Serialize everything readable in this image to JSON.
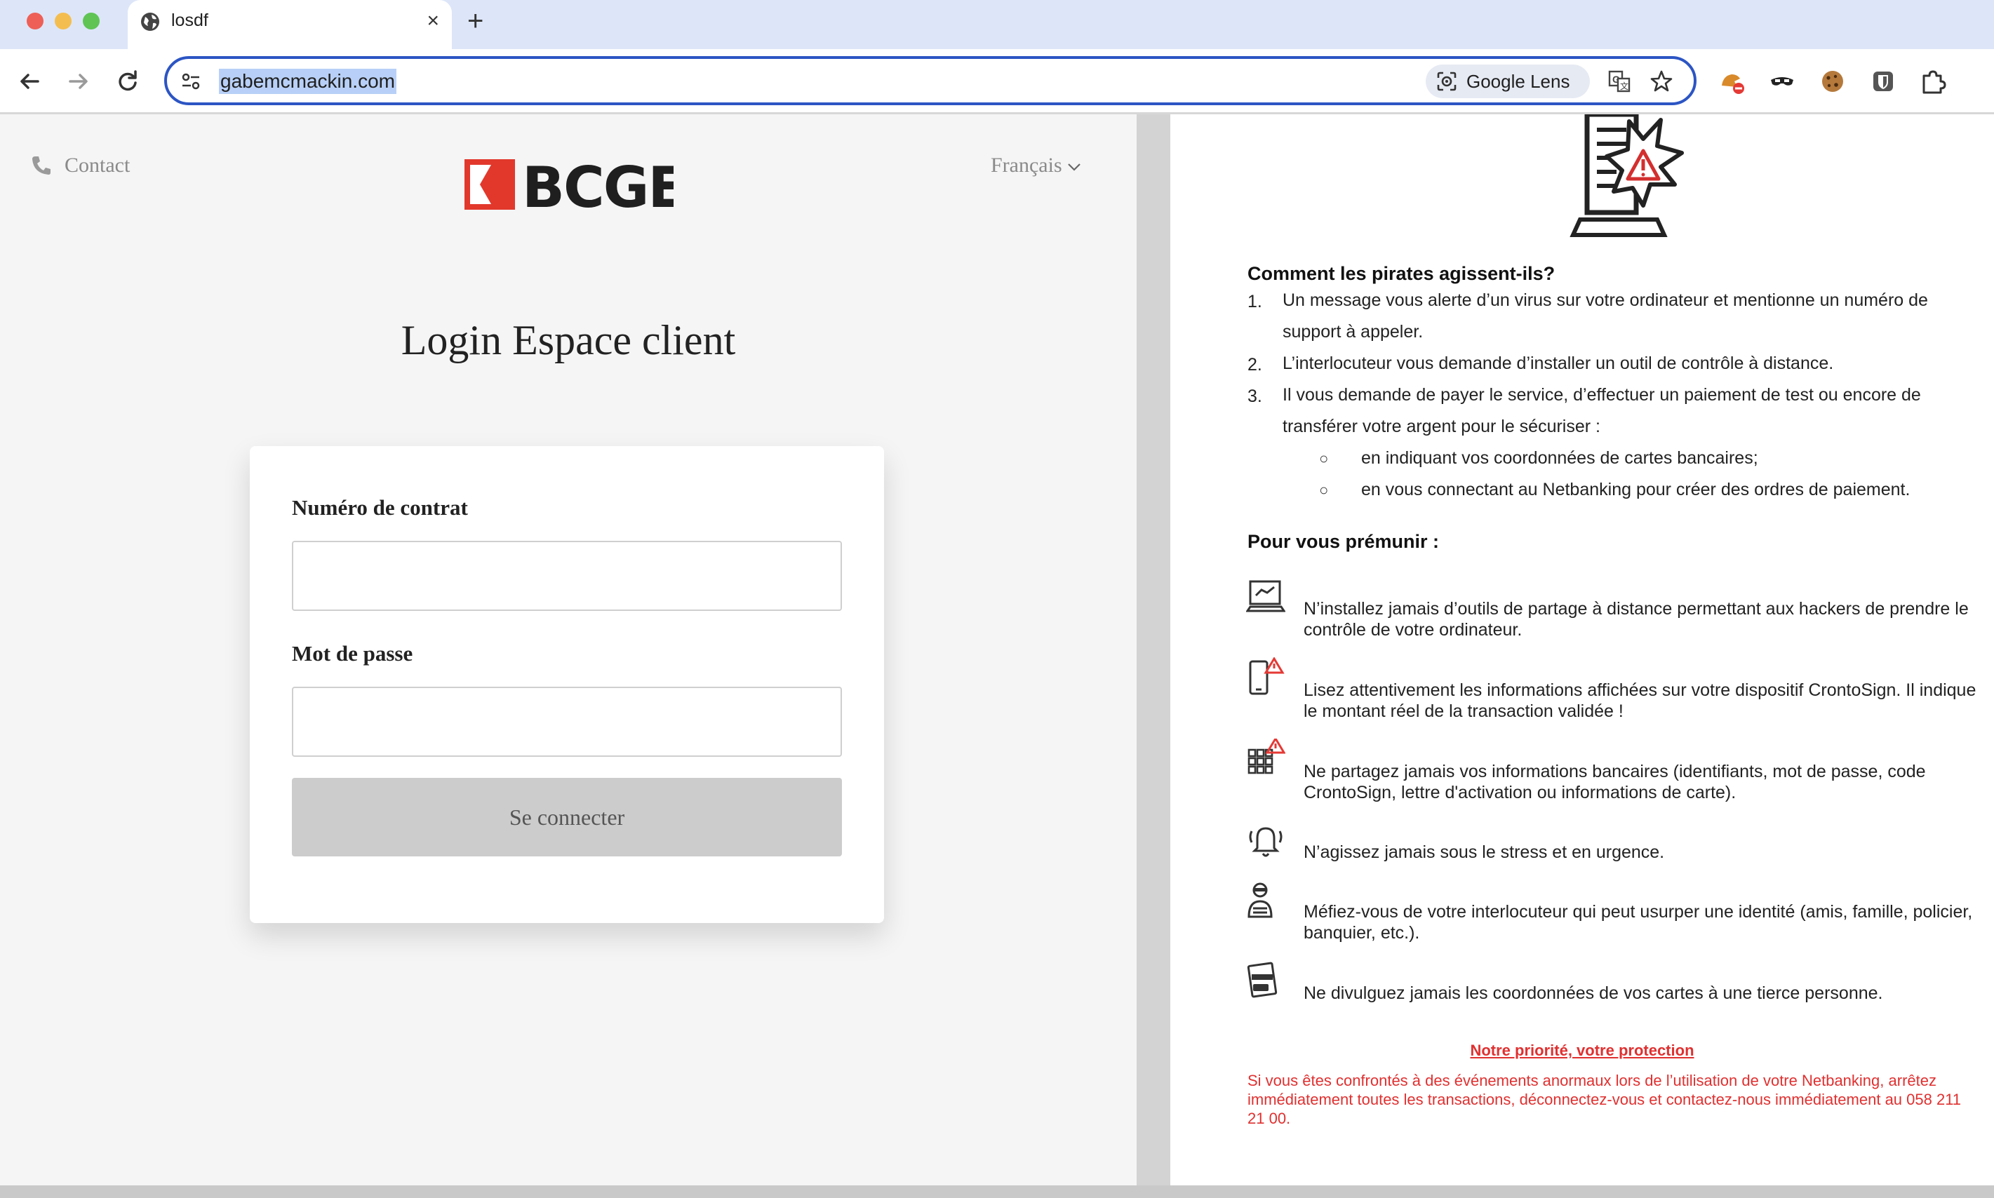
{
  "browser": {
    "tab_title": "losdf",
    "new_tab": "+",
    "tab_close": "×",
    "url": "gabemcmackin.com",
    "lens_label": "Google Lens"
  },
  "login": {
    "contact": "Contact",
    "language": "Français",
    "logo_text": "BCGE",
    "title": "Login Espace client",
    "contract_label": "Numéro de contrat",
    "password_label": "Mot de passe",
    "submit": "Se connecter"
  },
  "info": {
    "heading1": "Comment les pirates agissent-ils?",
    "steps": [
      {
        "num": "1.",
        "line1": "Un message vous alerte d’un virus sur votre ordinateur et mentionne un numéro de",
        "line2": "support à appeler."
      },
      {
        "num": "2.",
        "line1": "L’interlocuteur vous demande d’installer un outil de contrôle à distance.",
        "line2": ""
      },
      {
        "num": "3.",
        "line1": "Il vous demande de payer le service, d’effectuer un paiement de test ou encore de",
        "line2": "transférer votre argent pour le sécuriser :"
      }
    ],
    "bullet_symbol": "○",
    "bullets": [
      "en indiquant vos coordonnées de cartes bancaires;",
      "en vous connectant au Netbanking pour créer des ordres de paiement."
    ],
    "heading2": "Pour vous prémunir :",
    "tips": [
      {
        "icon": "laptop-handshake-icon",
        "text": "N’installez jamais d’outils de partage à distance permettant aux hackers de prendre le contrôle de votre ordinateur."
      },
      {
        "icon": "phone-warning-icon",
        "text": "Lisez attentivement les informations affichées sur votre dispositif CrontoSign. Il indique le montant réel de la transaction validée !"
      },
      {
        "icon": "grid-warning-icon",
        "text": "Ne partagez jamais vos informations bancaires (identifiants, mot de passe, code CrontoSign, lettre d'activation ou informations de carte)."
      },
      {
        "icon": "bell-alarm-icon",
        "text": "N’agissez jamais sous le stress et en urgence."
      },
      {
        "icon": "impostor-icon",
        "text": "Méfiez-vous de votre interlocuteur qui peut usurper une identité (amis, famille, policier, banquier, etc.)."
      },
      {
        "icon": "cards-icon",
        "text": "Ne divulguez jamais les coordonnées de vos cartes à une tierce personne."
      }
    ],
    "priority": "Notre priorité, votre protection",
    "warning": "Si vous êtes confrontés à des événements anormaux lors de l’utilisation de votre Netbanking, arrêtez immédiatement toutes les transactions, déconnectez-vous et contactez-nous immédiatement au 058 211 21 00."
  },
  "colors": {
    "brand_red": "#e2382c",
    "omnibox_border": "#2c55c4",
    "warning_text": "#e03030"
  }
}
